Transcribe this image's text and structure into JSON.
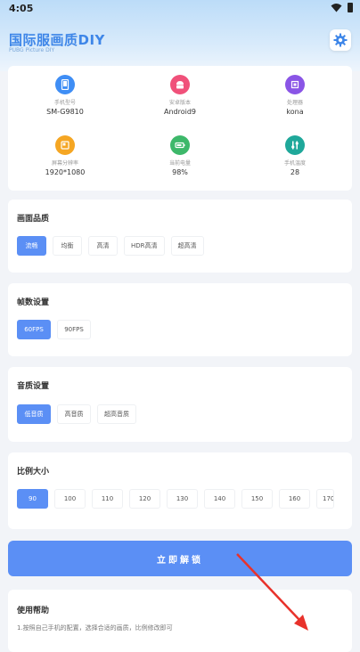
{
  "status": {
    "time": "4:05"
  },
  "app": {
    "title": "国际服画质DIY",
    "subtitle": "PUBG Picture DIY"
  },
  "device_info": [
    {
      "label": "手机型号",
      "value": "SM-G9810",
      "icon": "phone-icon",
      "color": "#3f8ef5"
    },
    {
      "label": "安卓版本",
      "value": "Android9",
      "icon": "android-icon",
      "color": "#f0517a"
    },
    {
      "label": "处理器",
      "value": "kona",
      "icon": "cpu-icon",
      "color": "#8a55e6"
    },
    {
      "label": "屏幕分辨率",
      "value": "1920*1080",
      "icon": "screen-icon",
      "color": "#f5a623"
    },
    {
      "label": "当前电量",
      "value": "98%",
      "icon": "battery-icon",
      "color": "#3db86a"
    },
    {
      "label": "手机温度",
      "value": "28",
      "icon": "thermometer-icon",
      "color": "#1fa89a"
    }
  ],
  "quality": {
    "title": "画面品质",
    "options": [
      "流畅",
      "均衡",
      "高清",
      "HDR高清",
      "超高清"
    ],
    "selected": 0
  },
  "fps": {
    "title": "帧数设置",
    "options": [
      "60FPS",
      "90FPS"
    ],
    "selected": 0
  },
  "audio": {
    "title": "音质设置",
    "options": [
      "低音质",
      "高音质",
      "超高音质"
    ],
    "selected": 0
  },
  "ratio": {
    "title": "比例大小",
    "options": [
      "90",
      "100",
      "110",
      "120",
      "130",
      "140",
      "150",
      "160",
      "170"
    ],
    "selected": 0
  },
  "start_button": {
    "label": "立即解锁"
  },
  "help": {
    "title": "使用帮助",
    "text": "1.按照自己手机的配置，选择合适的画质，比例修改即可"
  },
  "colors": {
    "accent": "#5b8ff5",
    "title_blue": "#3e86e8",
    "arrow": "#e8322b"
  }
}
